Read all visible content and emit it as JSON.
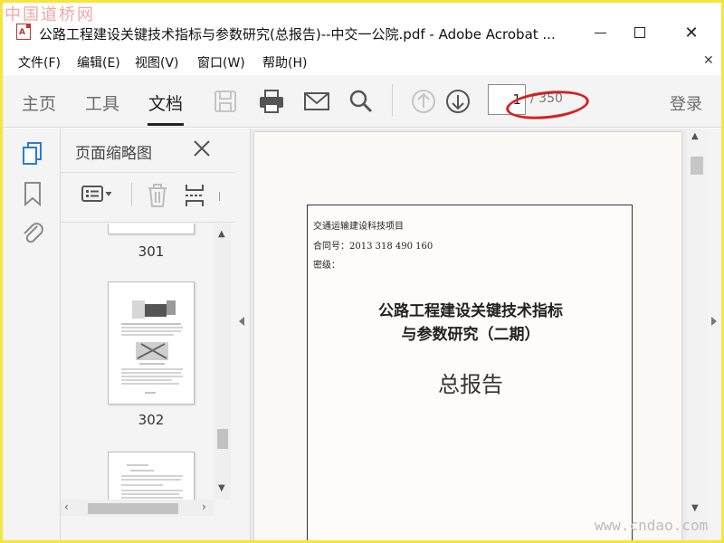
{
  "watermark_top": "中国道桥网",
  "watermark_bottom": "www.cndao.com",
  "window": {
    "title": "公路工程建设关键技术指标与参数研究(总报告)--中交一公院.pdf - Adobe Acrobat ...",
    "app_icon": "pdf-icon"
  },
  "menu": [
    "文件(F)",
    "编辑(E)",
    "视图(V)",
    "窗口(W)",
    "帮助(H)"
  ],
  "toolbar": {
    "tabs": [
      "主页",
      "工具",
      "文档"
    ],
    "active_tab": "文档",
    "page_current": "1",
    "page_total": "/ 350",
    "login": "登录",
    "icons": [
      "save-icon",
      "print-icon",
      "email-icon",
      "search-icon",
      "prev-page-icon",
      "next-page-icon"
    ]
  },
  "nav_rail": {
    "icons": [
      "page-thumbnails-icon",
      "bookmark-icon",
      "attachment-icon"
    ]
  },
  "thumbnail_panel": {
    "title": "页面缩略图",
    "thumbnails": [
      {
        "label": "301"
      },
      {
        "label": "302"
      }
    ]
  },
  "document": {
    "meta": [
      "交通运输建设科技项目",
      "合同号：2013 318 490 160",
      "密级："
    ],
    "title_line1": "公路工程建设关键技术指标",
    "title_line2": "与参数研究（二期）",
    "subtitle": "总报告"
  },
  "colors": {
    "accent_blue": "#2c7bd6",
    "annotation_red": "#d42121",
    "outer_border": "#f6e53c"
  }
}
